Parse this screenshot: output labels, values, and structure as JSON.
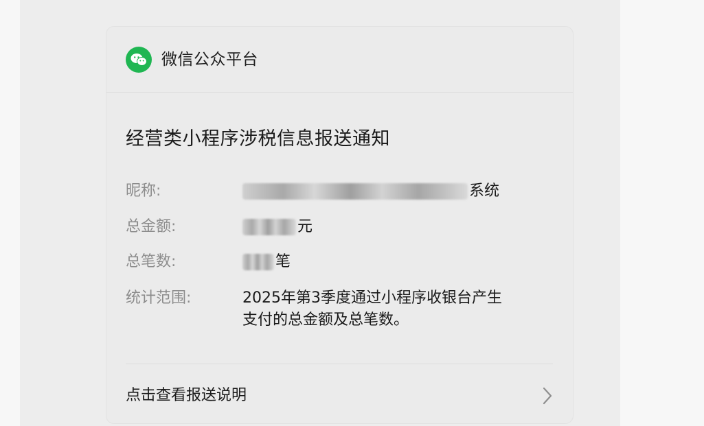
{
  "header": {
    "account_name": "微信公众平台",
    "logo_icon": "wechat-logo-icon",
    "logo_color": "#1fb652"
  },
  "notice": {
    "title": "经营类小程序涉税信息报送通知",
    "fields": [
      {
        "label": "昵称:",
        "value_suffix": "系统"
      },
      {
        "label": "总金额:",
        "value_suffix": "元"
      },
      {
        "label": "总笔数:",
        "value_suffix": "笔"
      },
      {
        "label": "统计范围:",
        "value_line1": "2025年第3季度通过小程序收银台产生",
        "value_line2": "支付的总金额及总笔数。"
      }
    ]
  },
  "footer": {
    "link_text": "点击查看报送说明",
    "chevron_icon": "chevron-right-icon"
  }
}
